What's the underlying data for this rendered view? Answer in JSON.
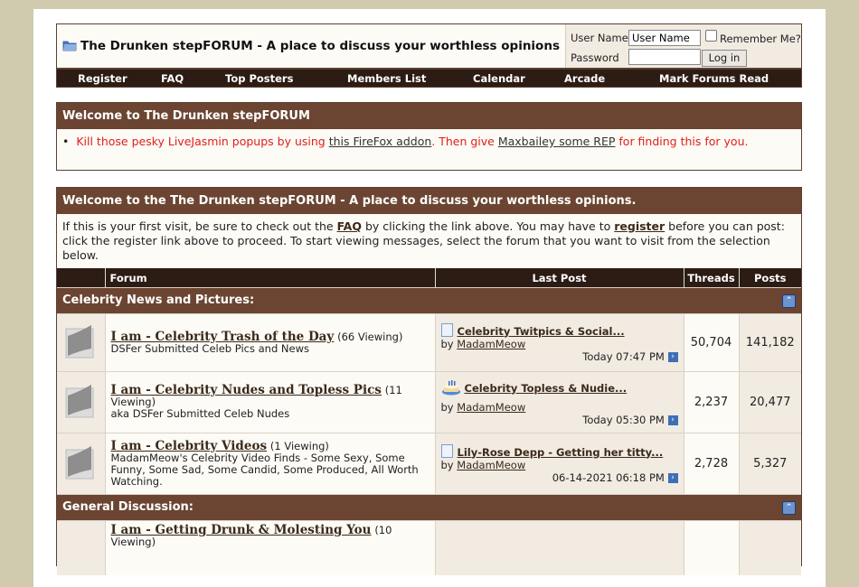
{
  "header": {
    "title": "The Drunken stepFORUM - A place to discuss your worthless opinions",
    "login": {
      "username_label": "User Name",
      "username_value": "User Name",
      "password_label": "Password",
      "password_value": "",
      "remember_label": "Remember Me?",
      "login_button": "Log in"
    }
  },
  "navbar": [
    "Register",
    "FAQ",
    "Top Posters",
    "Members List",
    "Calendar",
    "Arcade",
    "Mark Forums Read"
  ],
  "notice": {
    "title": "Welcome to The Drunken stepFORUM",
    "text1": "Kill those pesky LiveJasmin popups by using ",
    "link1": "this FireFox addon",
    "text2": ". Then give ",
    "link2": "Maxbailey some REP",
    "text3": " for finding this for you."
  },
  "welcome": {
    "title": "Welcome to the The Drunken stepFORUM - A place to discuss your worthless opinions.",
    "t1": "If this is your first visit, be sure to check out the ",
    "faq": "FAQ",
    "t2": " by clicking the link above. You may have to ",
    "register": "register",
    "t3": " before you can post: click the register link above to proceed. To start viewing messages, select the forum that you want to visit from the selection below."
  },
  "table": {
    "headers": {
      "forum": "Forum",
      "last_post": "Last Post",
      "threads": "Threads",
      "posts": "Posts"
    },
    "categories": [
      {
        "name": "Celebrity News and Pictures:",
        "forums": [
          {
            "name": "I am - Celebrity Trash of the Day",
            "viewing": "(66 Viewing)",
            "description": "DSFer Submitted Celeb Pics and News",
            "last_thread": "Celebrity Twitpics & Social...",
            "last_thread_icon": "document-icon",
            "by_label": "by",
            "last_user": "MadamMeow",
            "last_time": "Today 07:47 PM",
            "threads": "50,704",
            "posts": "141,182"
          },
          {
            "name": "I am - Celebrity Nudes and Topless Pics",
            "viewing": "(11 Viewing)",
            "description": "aka DSFer Submitted Celeb Nudes",
            "last_thread": "Celebrity Topless & Nudie...",
            "last_thread_icon": "cake-icon",
            "by_label": "by",
            "last_user": "MadamMeow",
            "last_time": "Today 05:30 PM",
            "threads": "2,237",
            "posts": "20,477"
          },
          {
            "name": "I am - Celebrity Videos",
            "viewing": "(1 Viewing)",
            "description": "MadamMeow's Celebrity Video Finds - Some Sexy, Some Funny, Some Sad, Some Candid, Some Produced, All Worth Watching.",
            "last_thread": "Lily-Rose Depp - Getting her titty...",
            "last_thread_icon": "document-icon",
            "by_label": "by",
            "last_user": "MadamMeow",
            "last_time": "06-14-2021 06:18 PM",
            "threads": "2,728",
            "posts": "5,327"
          }
        ]
      },
      {
        "name": "General Discussion:",
        "forums": [
          {
            "name": "I am - Getting Drunk & Molesting You",
            "viewing": "(10 Viewing)"
          }
        ]
      }
    ]
  }
}
